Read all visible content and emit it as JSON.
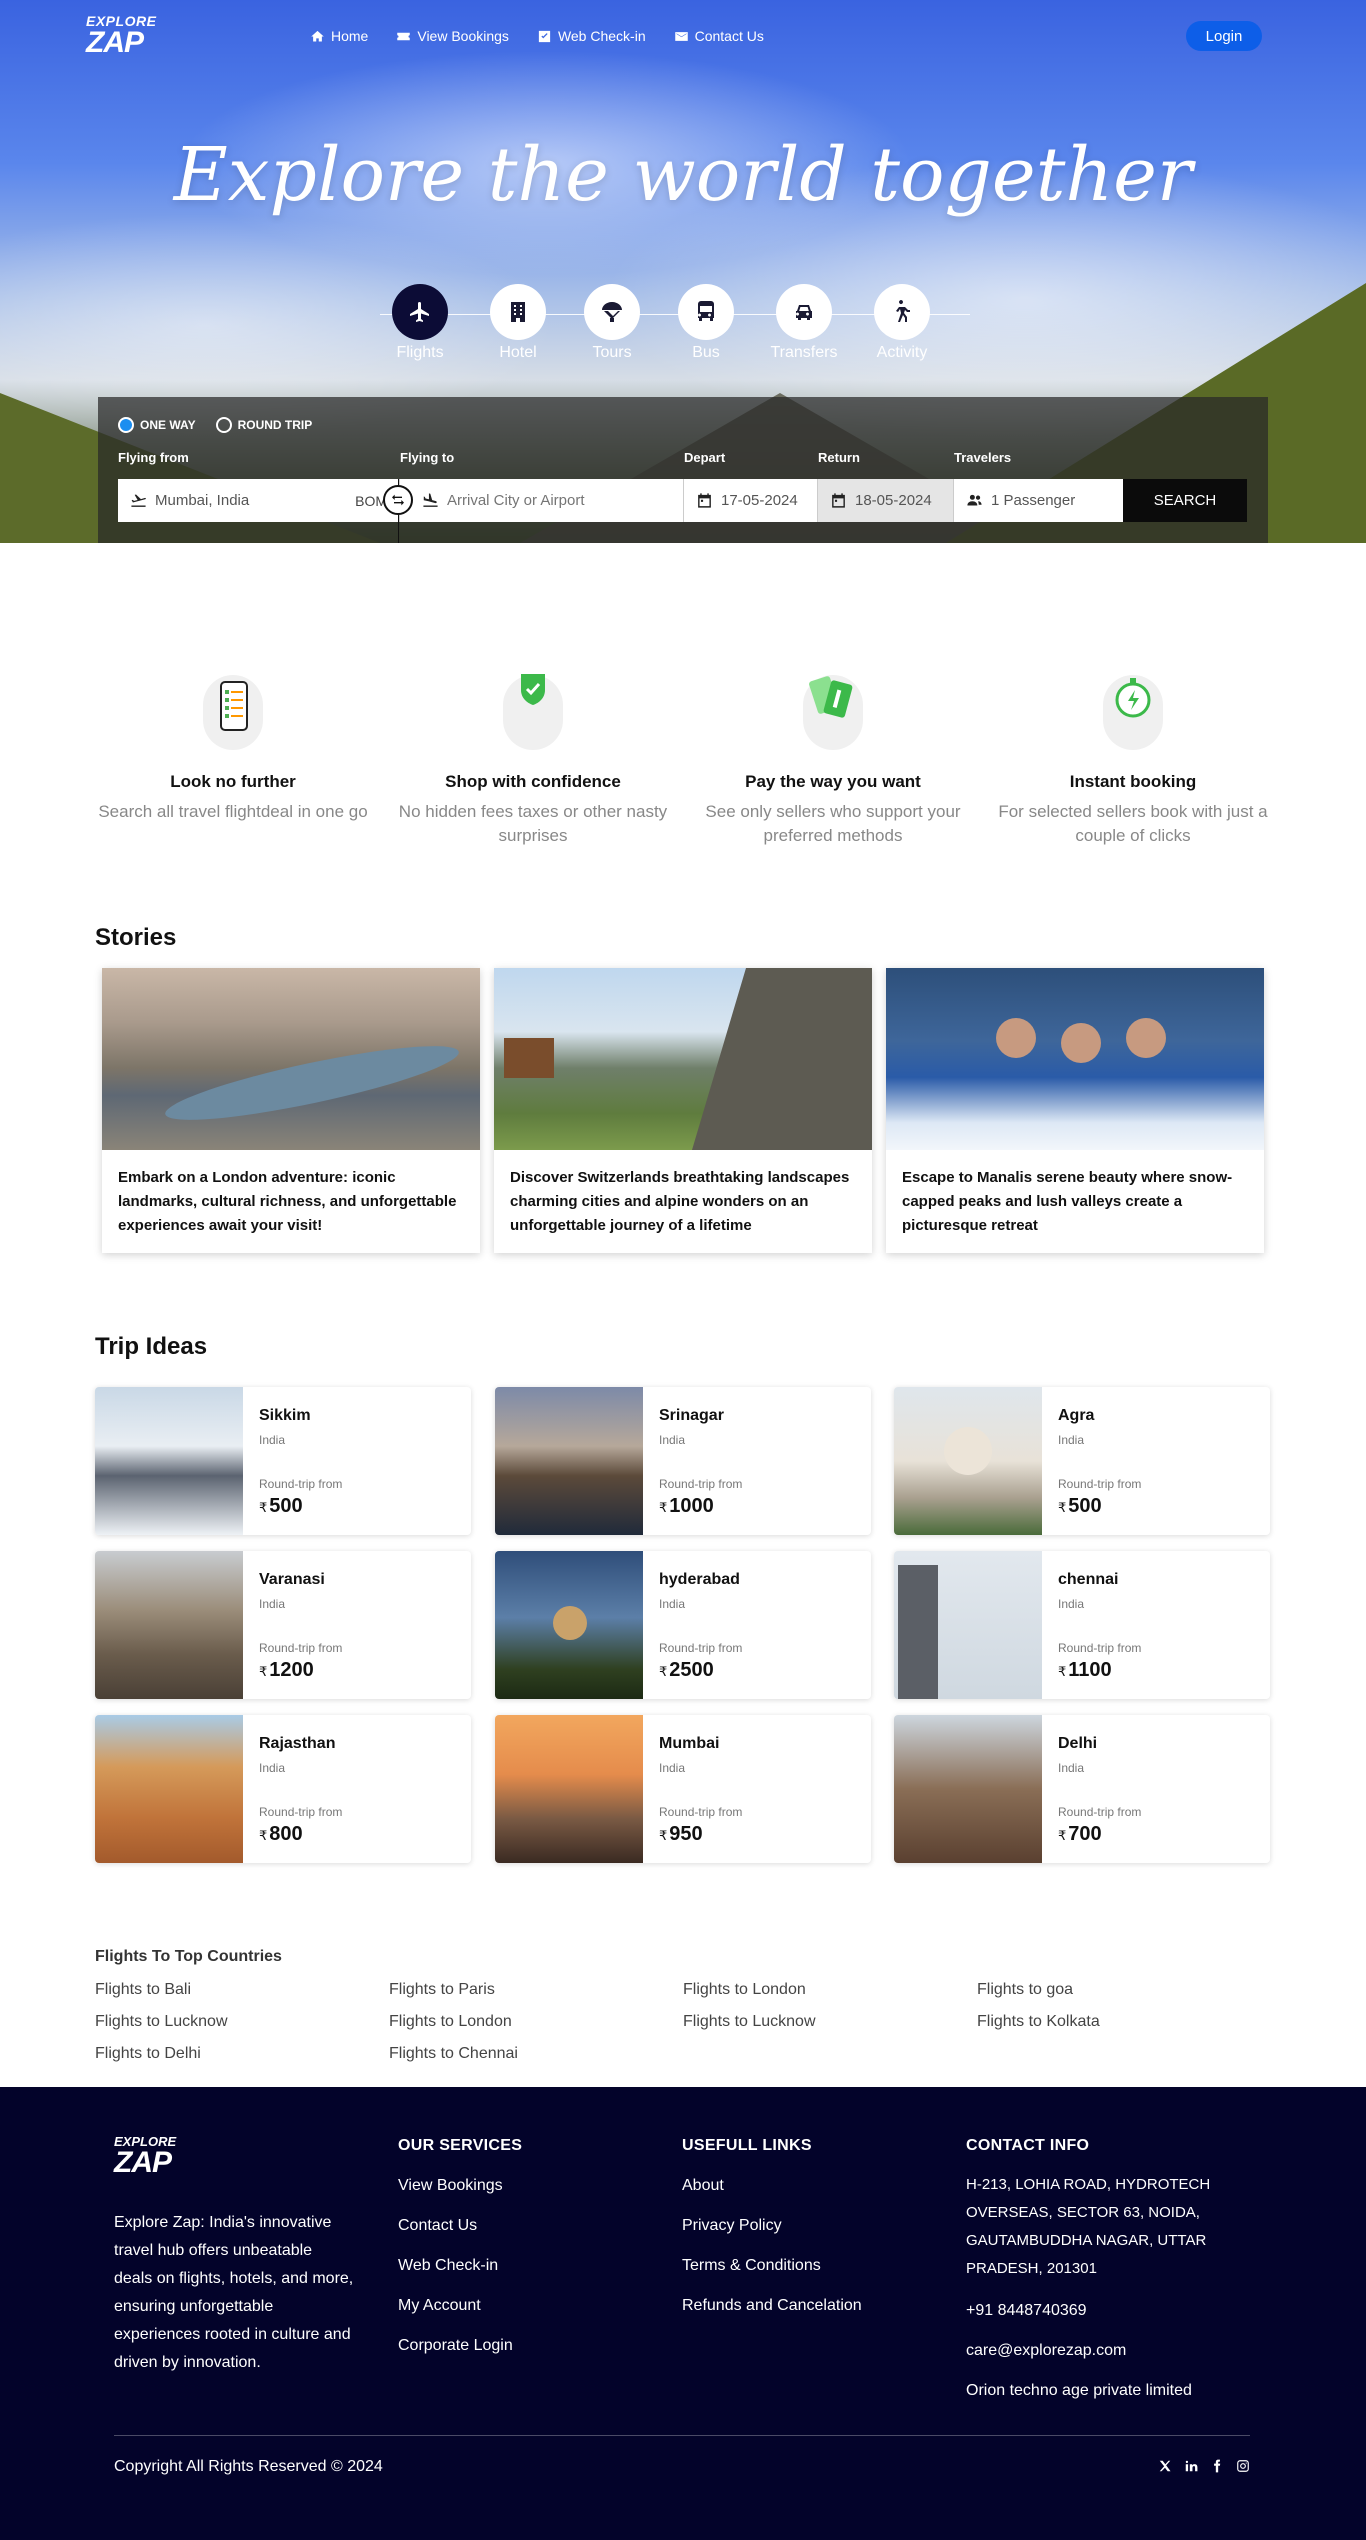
{
  "brand": {
    "logo_top": "EXPLORE",
    "logo_bottom": "ZAP"
  },
  "nav": {
    "items": [
      {
        "label": "Home",
        "icon": "home-icon"
      },
      {
        "label": "View Bookings",
        "icon": "ticket-icon"
      },
      {
        "label": "Web Check-in",
        "icon": "check-square-icon"
      },
      {
        "label": "Contact Us",
        "icon": "mail-icon"
      }
    ],
    "login_label": "Login"
  },
  "hero": {
    "title": "Explore the world together"
  },
  "modes": [
    {
      "label": "Flights",
      "icon": "plane-icon",
      "active": true
    },
    {
      "label": "Hotel",
      "icon": "hotel-icon",
      "active": false
    },
    {
      "label": "Tours",
      "icon": "parachute-icon",
      "active": false
    },
    {
      "label": "Bus",
      "icon": "bus-icon",
      "active": false
    },
    {
      "label": "Transfers",
      "icon": "car-icon",
      "active": false
    },
    {
      "label": "Activity",
      "icon": "hiking-icon",
      "active": false
    }
  ],
  "search": {
    "trip_types": [
      "ONE WAY",
      "ROUND TRIP"
    ],
    "selected_trip_type": "ONE WAY",
    "flying_from_label": "Flying from",
    "flying_from_value": "Mumbai, India",
    "flying_from_code": "BOM",
    "flying_to_label": "Flying to",
    "flying_to_placeholder": "Arrival City or Airport",
    "depart_label": "Depart",
    "depart_value": "17-05-2024",
    "return_label": "Return",
    "return_value": "18-05-2024",
    "travelers_label": "Travelers",
    "travelers_value": "1 Passenger",
    "search_label": "SEARCH"
  },
  "features": [
    {
      "title": "Look no further",
      "desc": "Search all travel flightdeal in one go",
      "icon": "phone-checklist-icon"
    },
    {
      "title": "Shop with confidence",
      "desc": "No hidden fees taxes or other nasty surprises",
      "icon": "shield-check-icon"
    },
    {
      "title": "Pay the way you want",
      "desc": "See only sellers who support your preferred methods",
      "icon": "payment-card-icon"
    },
    {
      "title": "Instant booking",
      "desc": "For selected sellers book with just a couple of clicks",
      "icon": "stopwatch-bolt-icon"
    }
  ],
  "stories": {
    "title": "Stories",
    "items": [
      {
        "caption": "Embark on a London adventure: iconic landmarks, cultural richness, and unforgettable experiences await your visit!"
      },
      {
        "caption": "Discover Switzerlands breathtaking landscapes charming cities and alpine wonders on an unforgettable journey of a lifetime"
      },
      {
        "caption": "Escape to Manalis serene beauty where snow-capped peaks and lush valleys create a picturesque retreat"
      }
    ]
  },
  "trip_ideas": {
    "title": "Trip Ideas",
    "roundtrip_label": "Round-trip from",
    "currency": "₹",
    "items": [
      {
        "name": "Sikkim",
        "country": "India",
        "price": "500"
      },
      {
        "name": "Srinagar",
        "country": "India",
        "price": "1000"
      },
      {
        "name": "Agra",
        "country": "India",
        "price": "500"
      },
      {
        "name": "Varanasi",
        "country": "India",
        "price": "1200"
      },
      {
        "name": "hyderabad",
        "country": "India",
        "price": "2500"
      },
      {
        "name": "chennai",
        "country": "India",
        "price": "1100"
      },
      {
        "name": "Rajasthan",
        "country": "India",
        "price": "800"
      },
      {
        "name": "Mumbai",
        "country": "India",
        "price": "950"
      },
      {
        "name": "Delhi",
        "country": "India",
        "price": "700"
      }
    ]
  },
  "top_flights": {
    "title": "Flights To Top Countries",
    "links": [
      "Flights to Bali",
      "Flights to Paris",
      "Flights to London",
      "Flights to goa",
      "Flights to Lucknow",
      "Flights to London",
      "Flights to Lucknow",
      "Flights to Kolkata",
      "Flights to Delhi",
      "Flights to Chennai"
    ]
  },
  "footer": {
    "about": "Explore Zap: India's innovative travel hub offers unbeatable deals on flights, hotels, and more, ensuring unforgettable experiences rooted in culture and driven by innovation.",
    "services_title": "OUR SERVICES",
    "services": [
      "View Bookings",
      "Contact Us",
      "Web Check-in",
      "My Account",
      "Corporate Login"
    ],
    "links_title": "USEFULL LINKS",
    "links": [
      "About",
      "Privacy Policy",
      "Terms & Conditions",
      "Refunds and Cancelation"
    ],
    "contact_title": "CONTACT INFO",
    "address": "H-213, LOHIA ROAD, HYDROTECH OVERSEAS, SECTOR 63, NOIDA, GAUTAMBUDDHA NAGAR, UTTAR PRADESH, 201301",
    "phone": "+91 8448740369",
    "email": "care@explorezap.com",
    "company": "Orion techno age private limited",
    "copyright": "Copyright All Rights Reserved © 2024",
    "socials": [
      "x-icon",
      "linkedin-icon",
      "facebook-icon",
      "instagram-icon"
    ]
  }
}
